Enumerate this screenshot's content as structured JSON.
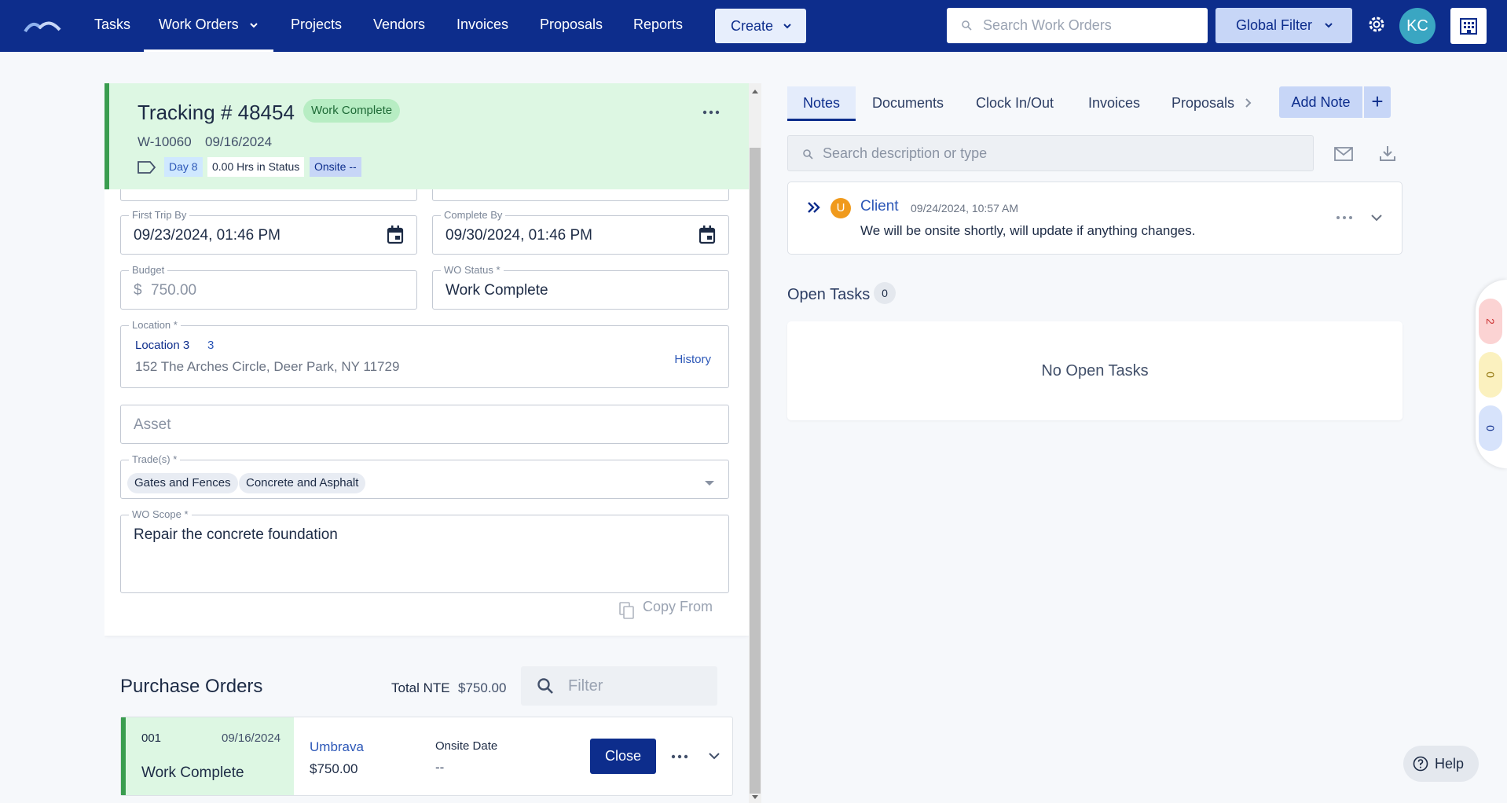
{
  "nav": {
    "items": [
      "Tasks",
      "Work Orders",
      "Projects",
      "Vendors",
      "Invoices",
      "Proposals",
      "Reports"
    ],
    "active": "Work Orders",
    "create_label": "Create",
    "search_placeholder": "Search Work Orders",
    "global_filter_label": "Global Filter",
    "avatar_initials": "KC"
  },
  "header": {
    "tracking": "Tracking # 48454",
    "status_badge": "Work Complete",
    "wo_number": "W-10060",
    "wo_date": "09/16/2024",
    "day": "Day 8",
    "hours_in_status": "0.00 Hrs in Status",
    "onsite": "Onsite --"
  },
  "form": {
    "first_trip_label": "First Trip By",
    "first_trip_value": "09/23/2024, 01:46 PM",
    "complete_by_label": "Complete By",
    "complete_by_value": "09/30/2024, 01:46 PM",
    "budget_label": "Budget",
    "budget_currency": "$",
    "budget_value": "750.00",
    "wo_status_label": "WO Status *",
    "wo_status_value": "Work Complete",
    "location_label": "Location *",
    "location_name": "Location 3",
    "location_count": "3",
    "location_address": "152 The Arches Circle, Deer Park, NY 11729",
    "history_label": "History",
    "asset_placeholder": "Asset",
    "trades_label": "Trade(s) *",
    "trades": [
      "Gates and Fences",
      "Concrete and Asphalt"
    ],
    "scope_label": "WO Scope *",
    "scope_value": "Repair the concrete foundation",
    "copy_from_label": "Copy From"
  },
  "purchase_orders": {
    "title": "Purchase Orders",
    "total_nte_label": "Total NTE",
    "total_nte_value": "$750.00",
    "filter_placeholder": "Filter",
    "rows": [
      {
        "number": "001",
        "date": "09/16/2024",
        "status": "Work Complete",
        "vendor": "Umbrava",
        "amount": "$750.00",
        "onsite_label": "Onsite Date",
        "onsite_value": "--",
        "close_label": "Close"
      }
    ]
  },
  "right": {
    "tabs": [
      "Notes",
      "Documents",
      "Clock In/Out",
      "Invoices",
      "Proposals"
    ],
    "active_tab": "Notes",
    "add_note_label": "Add Note",
    "add_plus": "+",
    "notes_search_placeholder": "Search description or type",
    "note": {
      "avatar": "U",
      "author": "Client",
      "time": "09/24/2024, 10:57 AM",
      "text": "We will be onsite shortly, will update if anything changes."
    },
    "open_tasks_title": "Open Tasks",
    "open_tasks_count": "0",
    "no_tasks_text": "No Open Tasks"
  },
  "side_counters": {
    "red": "2",
    "yellow": "0",
    "blue": "0"
  },
  "help_label": "Help",
  "colors": {
    "nav_bg": "#0d2d8c",
    "success_bg": "#ddf7e3",
    "success_accent": "#3a9d4f",
    "primary": "#0d2d8c",
    "link": "#2c57b7"
  },
  "icons": [
    "logo-icon",
    "chevron-down-icon",
    "search-icon",
    "gear-icon",
    "building-icon",
    "more-dots-icon",
    "tag-icon",
    "calendar-icon",
    "copy-icon",
    "mail-icon",
    "download-icon",
    "double-chevron-right-icon",
    "chevron-right-icon",
    "help-icon"
  ]
}
